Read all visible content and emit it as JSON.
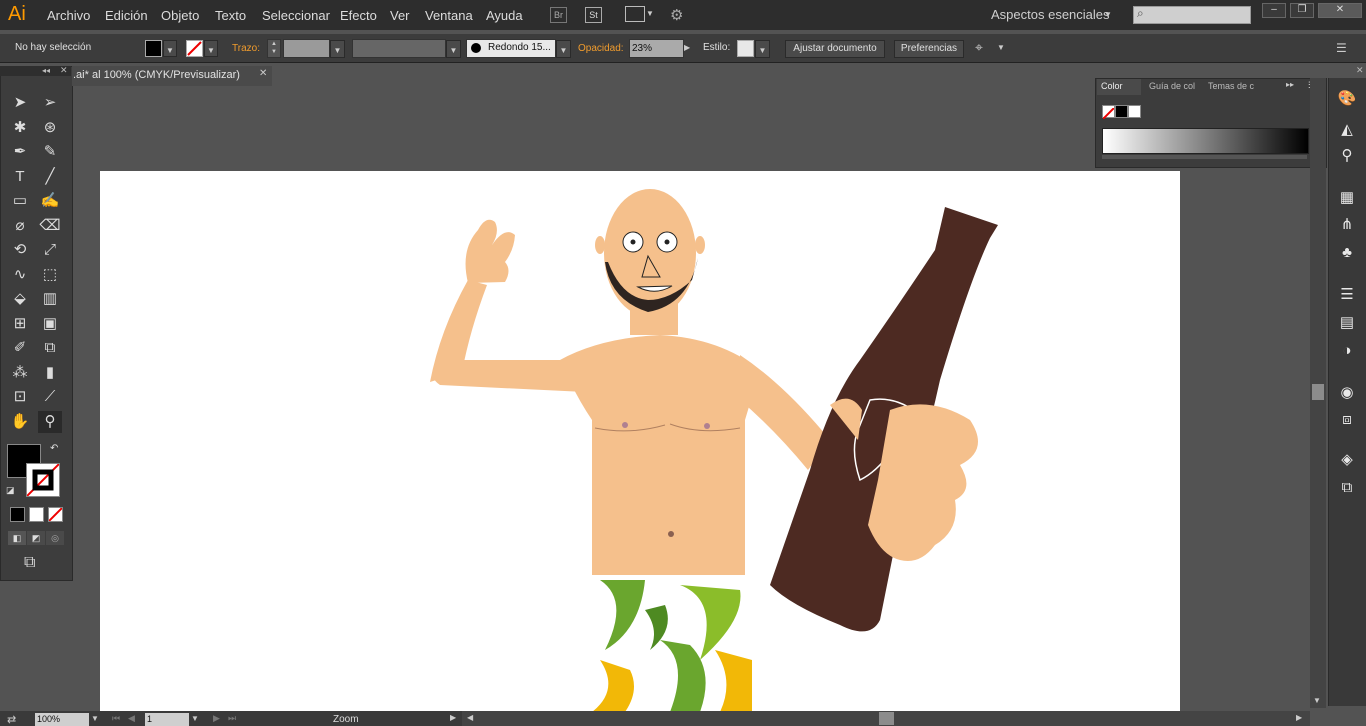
{
  "app": {
    "logo": "Ai"
  },
  "menu": [
    "Archivo",
    "Edición",
    "Objeto",
    "Texto",
    "Seleccionar",
    "Efecto",
    "Ver",
    "Ventana",
    "Ayuda"
  ],
  "bridge": {
    "br": "Br",
    "st": "St"
  },
  "workspace": "Aspectos esenciales",
  "control": {
    "selection": "No hay selección",
    "stroke_label": "Trazo:",
    "brush": "Redondo 15...",
    "opacity_label": "Opacidad:",
    "opacity": "23%",
    "style_label": "Estilo:",
    "fit_button": "Ajustar documento",
    "prefs_button": "Preferencias"
  },
  "document": {
    "tab": ".ai* al 100% (CMYK/Previsualizar)"
  },
  "color_panel": {
    "tabs": [
      "Color",
      "Guía de col",
      "Temas de c"
    ]
  },
  "status": {
    "zoom": "100%",
    "page": "1",
    "mode": "Zoom"
  },
  "colors": {
    "accent": "#f19c2d",
    "skin": "#f5c08c",
    "bottle": "#4d2a22",
    "shorts_green": "#6aa62e",
    "shorts_yellow": "#f2b807"
  },
  "icons": [
    "selection-tool-icon",
    "direct-selection-tool-icon",
    "magic-wand-icon",
    "lasso-icon",
    "pen-icon",
    "curvature-icon",
    "type-icon",
    "line-icon",
    "rectangle-icon",
    "brush-icon",
    "blob-brush-icon",
    "eraser-icon",
    "rotate-icon",
    "scale-icon",
    "warp-icon",
    "free-transform-icon",
    "shape-builder-icon",
    "perspective-icon",
    "mesh-icon",
    "gradient-icon",
    "eyedropper-icon",
    "blend-icon",
    "symbol-sprayer-icon",
    "graph-icon",
    "artboard-icon",
    "slice-icon",
    "hand-icon",
    "zoom-icon"
  ]
}
